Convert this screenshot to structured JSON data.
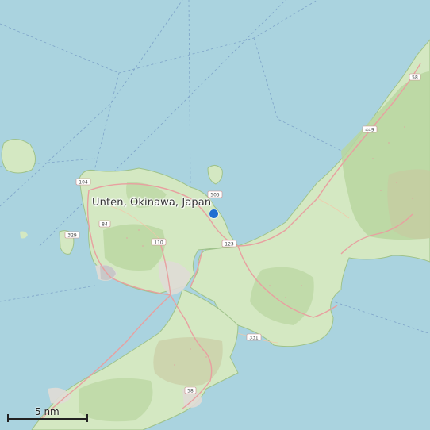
{
  "map": {
    "place_label": "Unten, Okinawa, Japan",
    "scale_label": "5 nm",
    "colors": {
      "water": "#aad3df",
      "land": "#d4e8c2",
      "forest": "#b9d6a0",
      "urban": "#e0dcd6",
      "road": "#e8a0a0",
      "marker": "#1f6fd1"
    },
    "road_refs": [
      {
        "label": "58",
        "name": "road-ref-58"
      },
      {
        "label": "505",
        "name": "road-ref-505"
      },
      {
        "label": "104",
        "name": "road-ref-104"
      },
      {
        "label": "84",
        "name": "road-ref-84"
      },
      {
        "label": "449",
        "name": "road-ref-449"
      },
      {
        "label": "110",
        "name": "road-ref-110"
      },
      {
        "label": "123",
        "name": "road-ref-123"
      },
      {
        "label": "58",
        "name": "road-ref-58-b"
      },
      {
        "label": "331",
        "name": "road-ref-331"
      },
      {
        "label": "329",
        "name": "road-ref-329"
      }
    ]
  }
}
